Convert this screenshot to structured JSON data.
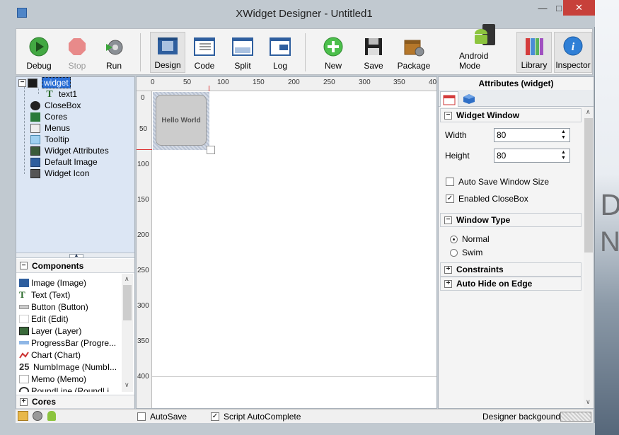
{
  "window": {
    "title": "XWidget Designer - Untitled1",
    "minimize": "—",
    "maximize": "□",
    "close": "✕"
  },
  "toolbar": {
    "debug": "Debug",
    "stop": "Stop",
    "run": "Run",
    "design": "Design",
    "code": "Code",
    "split": "Split",
    "log": "Log",
    "new": "New",
    "save": "Save",
    "package": "Package",
    "android_mode": "Android Mode",
    "library": "Library",
    "inspector": "Inspector"
  },
  "tree": {
    "root": "widget",
    "child": "text1",
    "items": [
      "CloseBox",
      "Cores",
      "Menus",
      "Tooltip",
      "Widget Attributes",
      "Default Image",
      "Widget Icon"
    ]
  },
  "components": {
    "header": "Components",
    "items": [
      "Image (Image)",
      "Text (Text)",
      "Button (Button)",
      "Edit (Edit)",
      "Layer (Layer)",
      "ProgressBar (Progre...",
      "Chart (Chart)",
      "NumbImage (NumbI...",
      "Memo (Memo)",
      "RoundLine (RoundLi..."
    ],
    "cores_header": "Cores"
  },
  "ruler": {
    "h": [
      "0",
      "50",
      "100",
      "150",
      "200",
      "250",
      "300",
      "350",
      "40"
    ],
    "v": [
      "0",
      "50",
      "100",
      "150",
      "200",
      "250",
      "300",
      "350",
      "400"
    ]
  },
  "canvas": {
    "widget_text": "Hello World"
  },
  "attributes": {
    "title": "Attributes (widget)",
    "group_widget_window": "Widget Window",
    "width_label": "Width",
    "width_value": "80",
    "height_label": "Height",
    "height_value": "80",
    "auto_save_size": "Auto Save Window Size",
    "enabled_closebox": "Enabled CloseBox",
    "group_window_type": "Window Type",
    "type_normal": "Normal",
    "type_swim": "Swim",
    "group_constraints": "Constraints",
    "group_autohide": "Auto Hide on Edge"
  },
  "status": {
    "autosave": "AutoSave",
    "script_autocomplete": "Script AutoComplete",
    "designer_bg": "Designer backgound"
  },
  "colors": {
    "accent": "#2b6fd6",
    "close_button": "#c7403a",
    "chrome": "#c1c9d0"
  }
}
